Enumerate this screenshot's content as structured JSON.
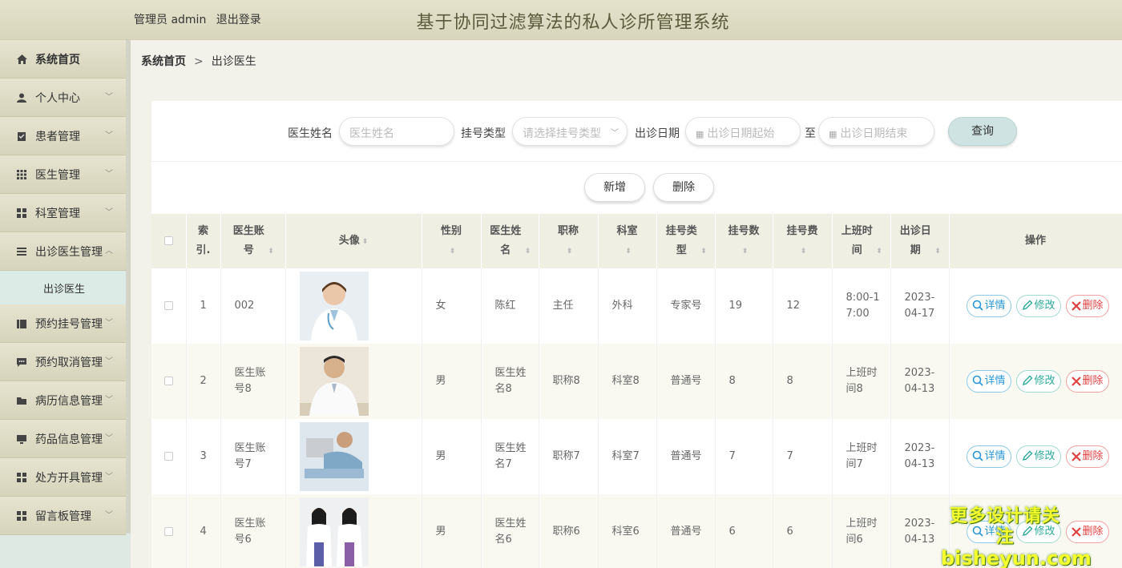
{
  "header": {
    "user": "管理员 admin",
    "logout": "退出登录",
    "title": "基于协同过滤算法的私人诊所管理系统"
  },
  "sidebar": {
    "home": "系统首页",
    "items": [
      {
        "label": "个人中心",
        "icon": "user-icon"
      },
      {
        "label": "患者管理",
        "icon": "clipboard-icon"
      },
      {
        "label": "医生管理",
        "icon": "grid-icon"
      },
      {
        "label": "科室管理",
        "icon": "apps-icon"
      },
      {
        "label": "出诊医生管理",
        "icon": "list-icon",
        "expanded": true
      },
      {
        "label": "预约挂号管理",
        "icon": "book-icon"
      },
      {
        "label": "预约取消管理",
        "icon": "comment-icon"
      },
      {
        "label": "病历信息管理",
        "icon": "folder-icon"
      },
      {
        "label": "药品信息管理",
        "icon": "monitor-icon"
      },
      {
        "label": "处方开具管理",
        "icon": "apps-icon"
      },
      {
        "label": "留言板管理",
        "icon": "apps-icon"
      }
    ],
    "submenu": "出诊医生"
  },
  "breadcrumb": {
    "root": "系统首页",
    "sep": ">",
    "current": "出诊医生"
  },
  "search": {
    "name_label": "医生姓名",
    "name_placeholder": "医生姓名",
    "type_label": "挂号类型",
    "type_placeholder": "请选择挂号类型",
    "date_label": "出诊日期",
    "date_start_placeholder": "出诊日期起始",
    "to": "至",
    "date_end_placeholder": "出诊日期结束",
    "query": "查询"
  },
  "actions": {
    "add": "新增",
    "delete": "删除"
  },
  "table": {
    "headers": {
      "index": "索引.",
      "account": "医生账号",
      "avatar": "头像",
      "gender": "性别",
      "name": "医生姓名",
      "title": "职称",
      "dept": "科室",
      "type": "挂号类型",
      "count": "挂号数",
      "fee": "挂号费",
      "worktime": "上班时间",
      "date": "出诊日期",
      "ops": "操作"
    },
    "ops": {
      "detail": "详情",
      "edit": "修改",
      "delete": "删除"
    },
    "rows": [
      {
        "index": "1",
        "account": "002",
        "gender": "女",
        "name": "陈红",
        "title": "主任",
        "dept": "外科",
        "type": "专家号",
        "count": "19",
        "fee": "12",
        "worktime": "8:00-17:00",
        "date": "2023-04-17"
      },
      {
        "index": "2",
        "account": "医生账号8",
        "gender": "男",
        "name": "医生姓名8",
        "title": "职称8",
        "dept": "科室8",
        "type": "普通号",
        "count": "8",
        "fee": "8",
        "worktime": "上班时间8",
        "date": "2023-04-13"
      },
      {
        "index": "3",
        "account": "医生账号7",
        "gender": "男",
        "name": "医生姓名7",
        "title": "职称7",
        "dept": "科室7",
        "type": "普通号",
        "count": "7",
        "fee": "7",
        "worktime": "上班时间7",
        "date": "2023-04-13"
      },
      {
        "index": "4",
        "account": "医生账号6",
        "gender": "男",
        "name": "医生姓名6",
        "title": "职称6",
        "dept": "科室6",
        "type": "普通号",
        "count": "6",
        "fee": "6",
        "worktime": "上班时间6",
        "date": "2023-04-13"
      }
    ]
  },
  "watermark": {
    "line1": "更多设计请关注",
    "line2": "bisheyun.com"
  },
  "colors": {
    "header_bg": "#ddddc4",
    "sidebar_bg": "#dcd9bf",
    "accent_teal": "#cfe3e3",
    "danger": "#e04040",
    "info": "#2a98d8",
    "success": "#2aa99a"
  }
}
